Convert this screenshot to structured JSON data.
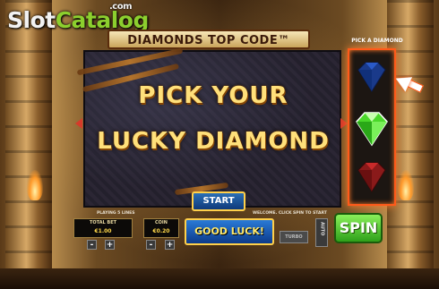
{
  "watermark": {
    "part1": "Slot",
    "part2": "Catalog",
    "suffix": ".com"
  },
  "game_title": "DIAMONDS TOP CODE™",
  "headline": {
    "line1": "PICK YOUR",
    "line2": "LUCKY DIAMOND"
  },
  "side_panel": {
    "label": "PICK A DIAMOND",
    "gems": [
      "blue-diamond",
      "green-diamond",
      "red-diamond"
    ]
  },
  "buttons": {
    "start": "START",
    "good_luck": "GOOD LUCK!",
    "turbo": "TURBO",
    "auto": "AUTO",
    "spin": "SPIN",
    "minus": "-",
    "plus": "+"
  },
  "status": {
    "left": "PLAYING 5 LINES",
    "right": "WELCOME. CLICK SPIN TO START"
  },
  "bet": {
    "total_label": "TOTAL BET",
    "total_value": "€1.00",
    "coin_label": "COIN",
    "coin_value": "€0.20"
  },
  "colors": {
    "headline": "#ffe07a",
    "panel_glow": "#ff5a1a",
    "spin": "#5ad03a",
    "start": "#1f5ea6",
    "gem_blue": "#1a4aa8",
    "gem_green": "#5ae03a",
    "gem_red": "#a81a1a"
  }
}
